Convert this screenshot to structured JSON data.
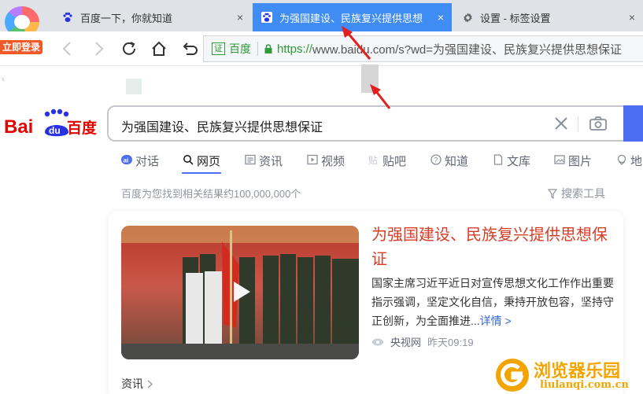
{
  "browser": {
    "login_badge": "立即登录",
    "tabs": [
      {
        "title": "百度一下，你就知道",
        "icon": "baidu-paw-icon",
        "active": false
      },
      {
        "title": "为强国建设、民族复兴提供思想",
        "icon": "baidu-paw-icon",
        "active": true
      },
      {
        "title": "设置 - 标签设置",
        "icon": "gear-icon",
        "active": false
      }
    ],
    "close_symbol": "×",
    "address": {
      "cert_box": "证",
      "cert_name": "百度",
      "url_scheme": "https://",
      "url_rest": "www.baidu.com/s?wd=为强国建设、民族复兴提供思想保证"
    },
    "accent_color": "#3e8cf4"
  },
  "baidu": {
    "search_query": "为强国建设、民族复兴提供思想保证",
    "nav_tabs": [
      {
        "label": "对话",
        "icon": "ai-icon"
      },
      {
        "label": "网页",
        "icon": "search-icon",
        "active": true
      },
      {
        "label": "资讯",
        "icon": "news-icon"
      },
      {
        "label": "视频",
        "icon": "video-icon"
      },
      {
        "label": "贴吧",
        "icon": "tieba-icon"
      },
      {
        "label": "知道",
        "icon": "question-icon"
      },
      {
        "label": "文库",
        "icon": "doc-icon"
      },
      {
        "label": "图片",
        "icon": "image-icon"
      },
      {
        "label": "地",
        "icon": "map-icon"
      }
    ],
    "result_count": "百度为您找到相关结果约100,000,000个",
    "search_tools": "搜索工具",
    "result": {
      "title_line1": "为强国建设、民族复兴提供思想保",
      "title_line2": "证",
      "abstract": "国家主席习近平近日对宣传思想文化工作作出重要指示强调，坚定文化自信，秉持开放包容，坚持守正创新，为全面推进...",
      "more_link": "详情 >",
      "source": "央视网",
      "time": "昨天09:19"
    },
    "news_label": "资讯",
    "brand_color": "#4e6ef2",
    "title_color": "#d63d27"
  },
  "watermark": {
    "text": "浏览器乐园",
    "url": "liulanqi.com.cn"
  }
}
